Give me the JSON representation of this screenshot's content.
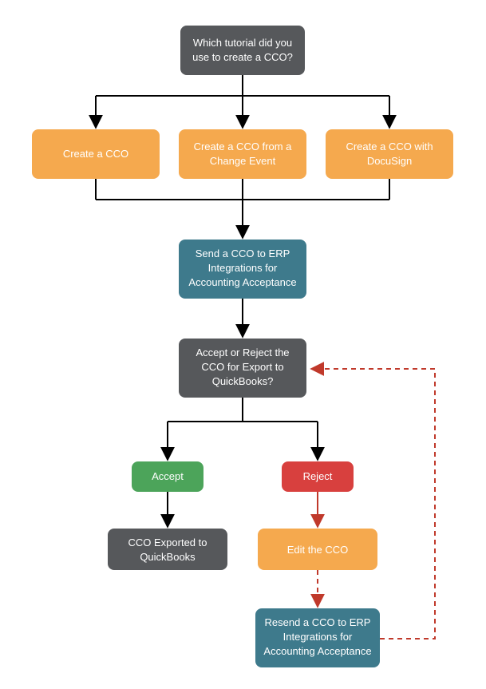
{
  "nodes": {
    "start": {
      "lines": [
        "Which tutorial did you",
        "use to create a CCO?"
      ],
      "color": "#56585B"
    },
    "optA": {
      "lines": [
        "Create a CCO"
      ],
      "color": "#F5A94E"
    },
    "optB": {
      "lines": [
        "Create a CCO from a",
        "Change Event"
      ],
      "color": "#F5A94E"
    },
    "optC": {
      "lines": [
        "Create a CCO with",
        "DocuSign"
      ],
      "color": "#F5A94E"
    },
    "send": {
      "lines": [
        "Send a CCO to ERP",
        "Integrations for",
        "Accounting Acceptance"
      ],
      "color": "#3E7A8C"
    },
    "decide": {
      "lines": [
        "Accept or Reject the",
        "CCO for Export to",
        "QuickBooks?"
      ],
      "color": "#56585B"
    },
    "accept": {
      "lines": [
        "Accept"
      ],
      "color": "#4CA45A"
    },
    "reject": {
      "lines": [
        "Reject"
      ],
      "color": "#D8403E"
    },
    "exported": {
      "lines": [
        "CCO Exported to",
        "QuickBooks"
      ],
      "color": "#56585B"
    },
    "edit": {
      "lines": [
        "Edit the CCO"
      ],
      "color": "#F5A94E"
    },
    "resend": {
      "lines": [
        "Resend a CCO to ERP",
        "Integrations for",
        "Accounting Acceptance"
      ],
      "color": "#3E7A8C"
    }
  }
}
